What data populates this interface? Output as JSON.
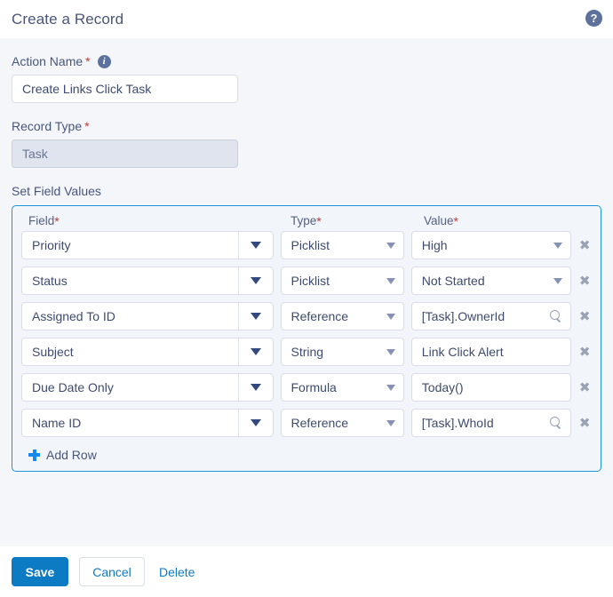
{
  "header": {
    "title": "Create a Record",
    "help_icon": "help-icon",
    "help_glyph": "?"
  },
  "form": {
    "action_name": {
      "label": "Action Name",
      "required_marker": "*",
      "info_glyph": "i",
      "value": "Create Links Click Task"
    },
    "record_type": {
      "label": "Record Type",
      "required_marker": "*",
      "value": "Task",
      "disabled": true
    },
    "set_field_values": {
      "label": "Set Field Values",
      "columns": [
        {
          "label": "Field",
          "required_marker": "*"
        },
        {
          "label": "Type",
          "required_marker": "*"
        },
        {
          "label": "Value",
          "required_marker": "*"
        }
      ],
      "rows": [
        {
          "field": "Priority",
          "type": "Picklist",
          "value": "High",
          "value_control": "picklist",
          "delete_glyph": "✖"
        },
        {
          "field": "Status",
          "type": "Picklist",
          "value": "Not Started",
          "value_control": "picklist",
          "delete_glyph": "✖"
        },
        {
          "field": "Assigned To ID",
          "type": "Reference",
          "value": "[Task].OwnerId",
          "value_control": "lookup",
          "delete_glyph": "✖"
        },
        {
          "field": "Subject",
          "type": "String",
          "value": "Link Click Alert",
          "value_control": "text",
          "delete_glyph": "✖"
        },
        {
          "field": "Due Date Only",
          "type": "Formula",
          "value": "Today()",
          "value_control": "text",
          "delete_glyph": "✖"
        },
        {
          "field": "Name ID",
          "type": "Reference",
          "value": "[Task].WhoId",
          "value_control": "lookup",
          "delete_glyph": "✖"
        }
      ],
      "add_row_label": "Add Row"
    }
  },
  "footer": {
    "save_label": "Save",
    "cancel_label": "Cancel",
    "delete_label": "Delete"
  },
  "colors": {
    "accent_blue": "#0d7bc4",
    "panel_border": "#1b96d8",
    "required_red": "#c23934",
    "text_slate": "#46527a",
    "page_bg": "#f4f6fa",
    "add_icon_blue": "#1589ee"
  }
}
